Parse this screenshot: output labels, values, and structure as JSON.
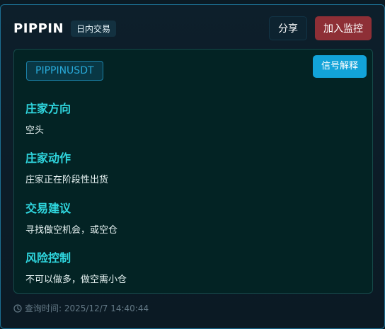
{
  "header": {
    "symbol": "PIPPIN",
    "mode_badge": "日内交易",
    "share_label": "分享",
    "monitor_label": "加入监控"
  },
  "panel": {
    "pair": "PIPPINUSDT",
    "signal_button": "信号解释",
    "sections": [
      {
        "title": "庄家方向",
        "value": "空头"
      },
      {
        "title": "庄家动作",
        "value": "庄家正在阶段性出货"
      },
      {
        "title": "交易建议",
        "value": "寻找做空机会，或空仓"
      },
      {
        "title": "风险控制",
        "value": "不可以做多，做空需小仓"
      }
    ]
  },
  "footer": {
    "icon": "clock-icon",
    "query_time": "查询时间: 2025/12/7 14:40:44"
  },
  "colors": {
    "accent_cyan": "#2fd6de",
    "button_blue": "#12a3d9",
    "monitor_red": "#8e2f36",
    "border_blue": "#1c6f93"
  }
}
